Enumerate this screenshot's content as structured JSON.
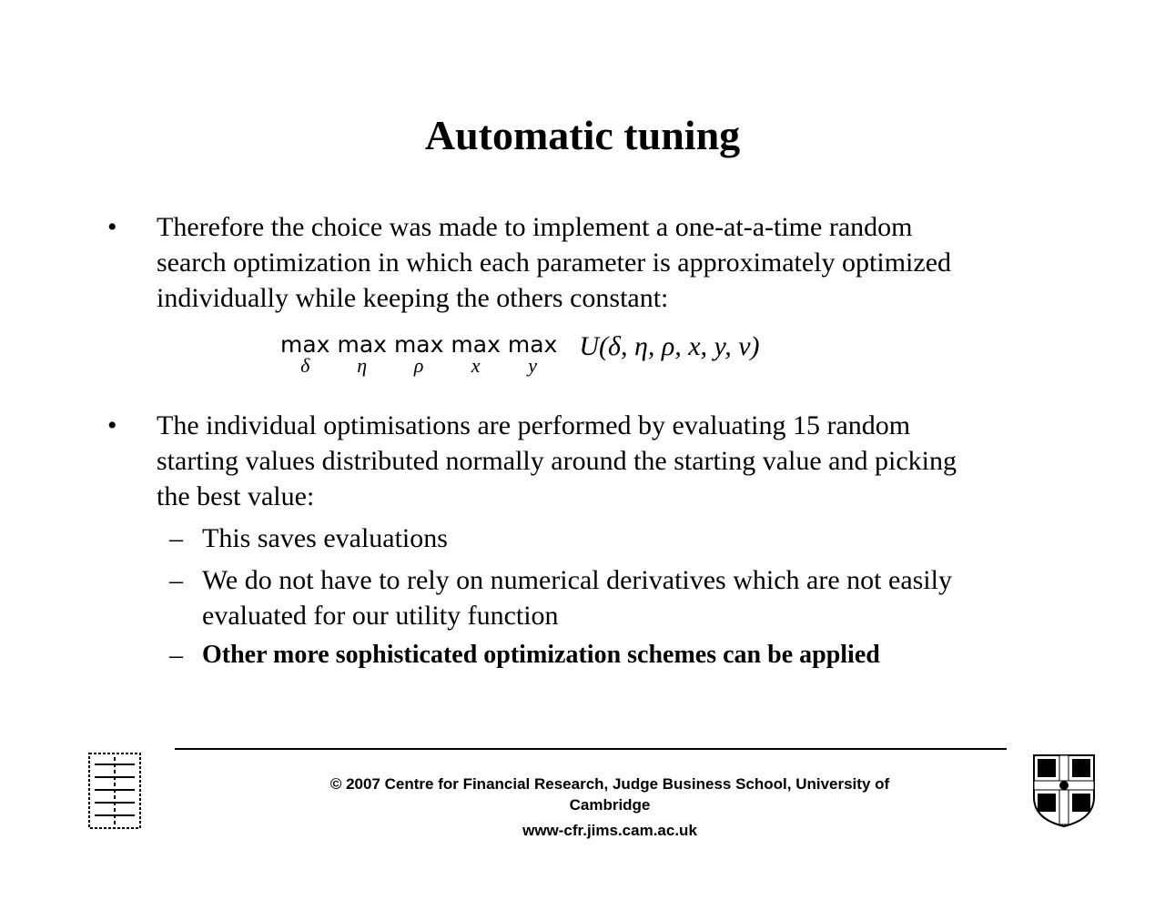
{
  "title": "Automatic tuning",
  "bullets": [
    {
      "lines": [
        "Therefore the choice was made to implement a one-at-a-time random",
        "search optimization in which each parameter is approximately optimized",
        "individually while keeping the others constant:"
      ]
    },
    {
      "lines": [
        "The individual optimisations are performed by evaluating 15 random",
        "starting values distributed normally around the starting value and picking",
        "the best value:"
      ]
    }
  ],
  "formula": {
    "op": "max",
    "subs": [
      "δ",
      "η",
      "ρ",
      "x",
      "y"
    ],
    "expr": "U(δ, η, ρ, x, y, ν)"
  },
  "subbullets": [
    {
      "lines": [
        "This saves evaluations"
      ]
    },
    {
      "lines": [
        "We do not have to rely on numerical derivatives which are not easily",
        "evaluated for our utility function"
      ]
    },
    {
      "lines": [
        "Other more sophisticated optimization schemes can be applied"
      ]
    }
  ],
  "footer": {
    "line1": "© 2007 Centre for Financial Research,  Judge Business School,  University of",
    "line2": "Cambridge",
    "url": "www-cfr.jims.cam.ac.uk"
  },
  "logos": {
    "left": "CFR logo",
    "right": "University of Cambridge crest"
  }
}
